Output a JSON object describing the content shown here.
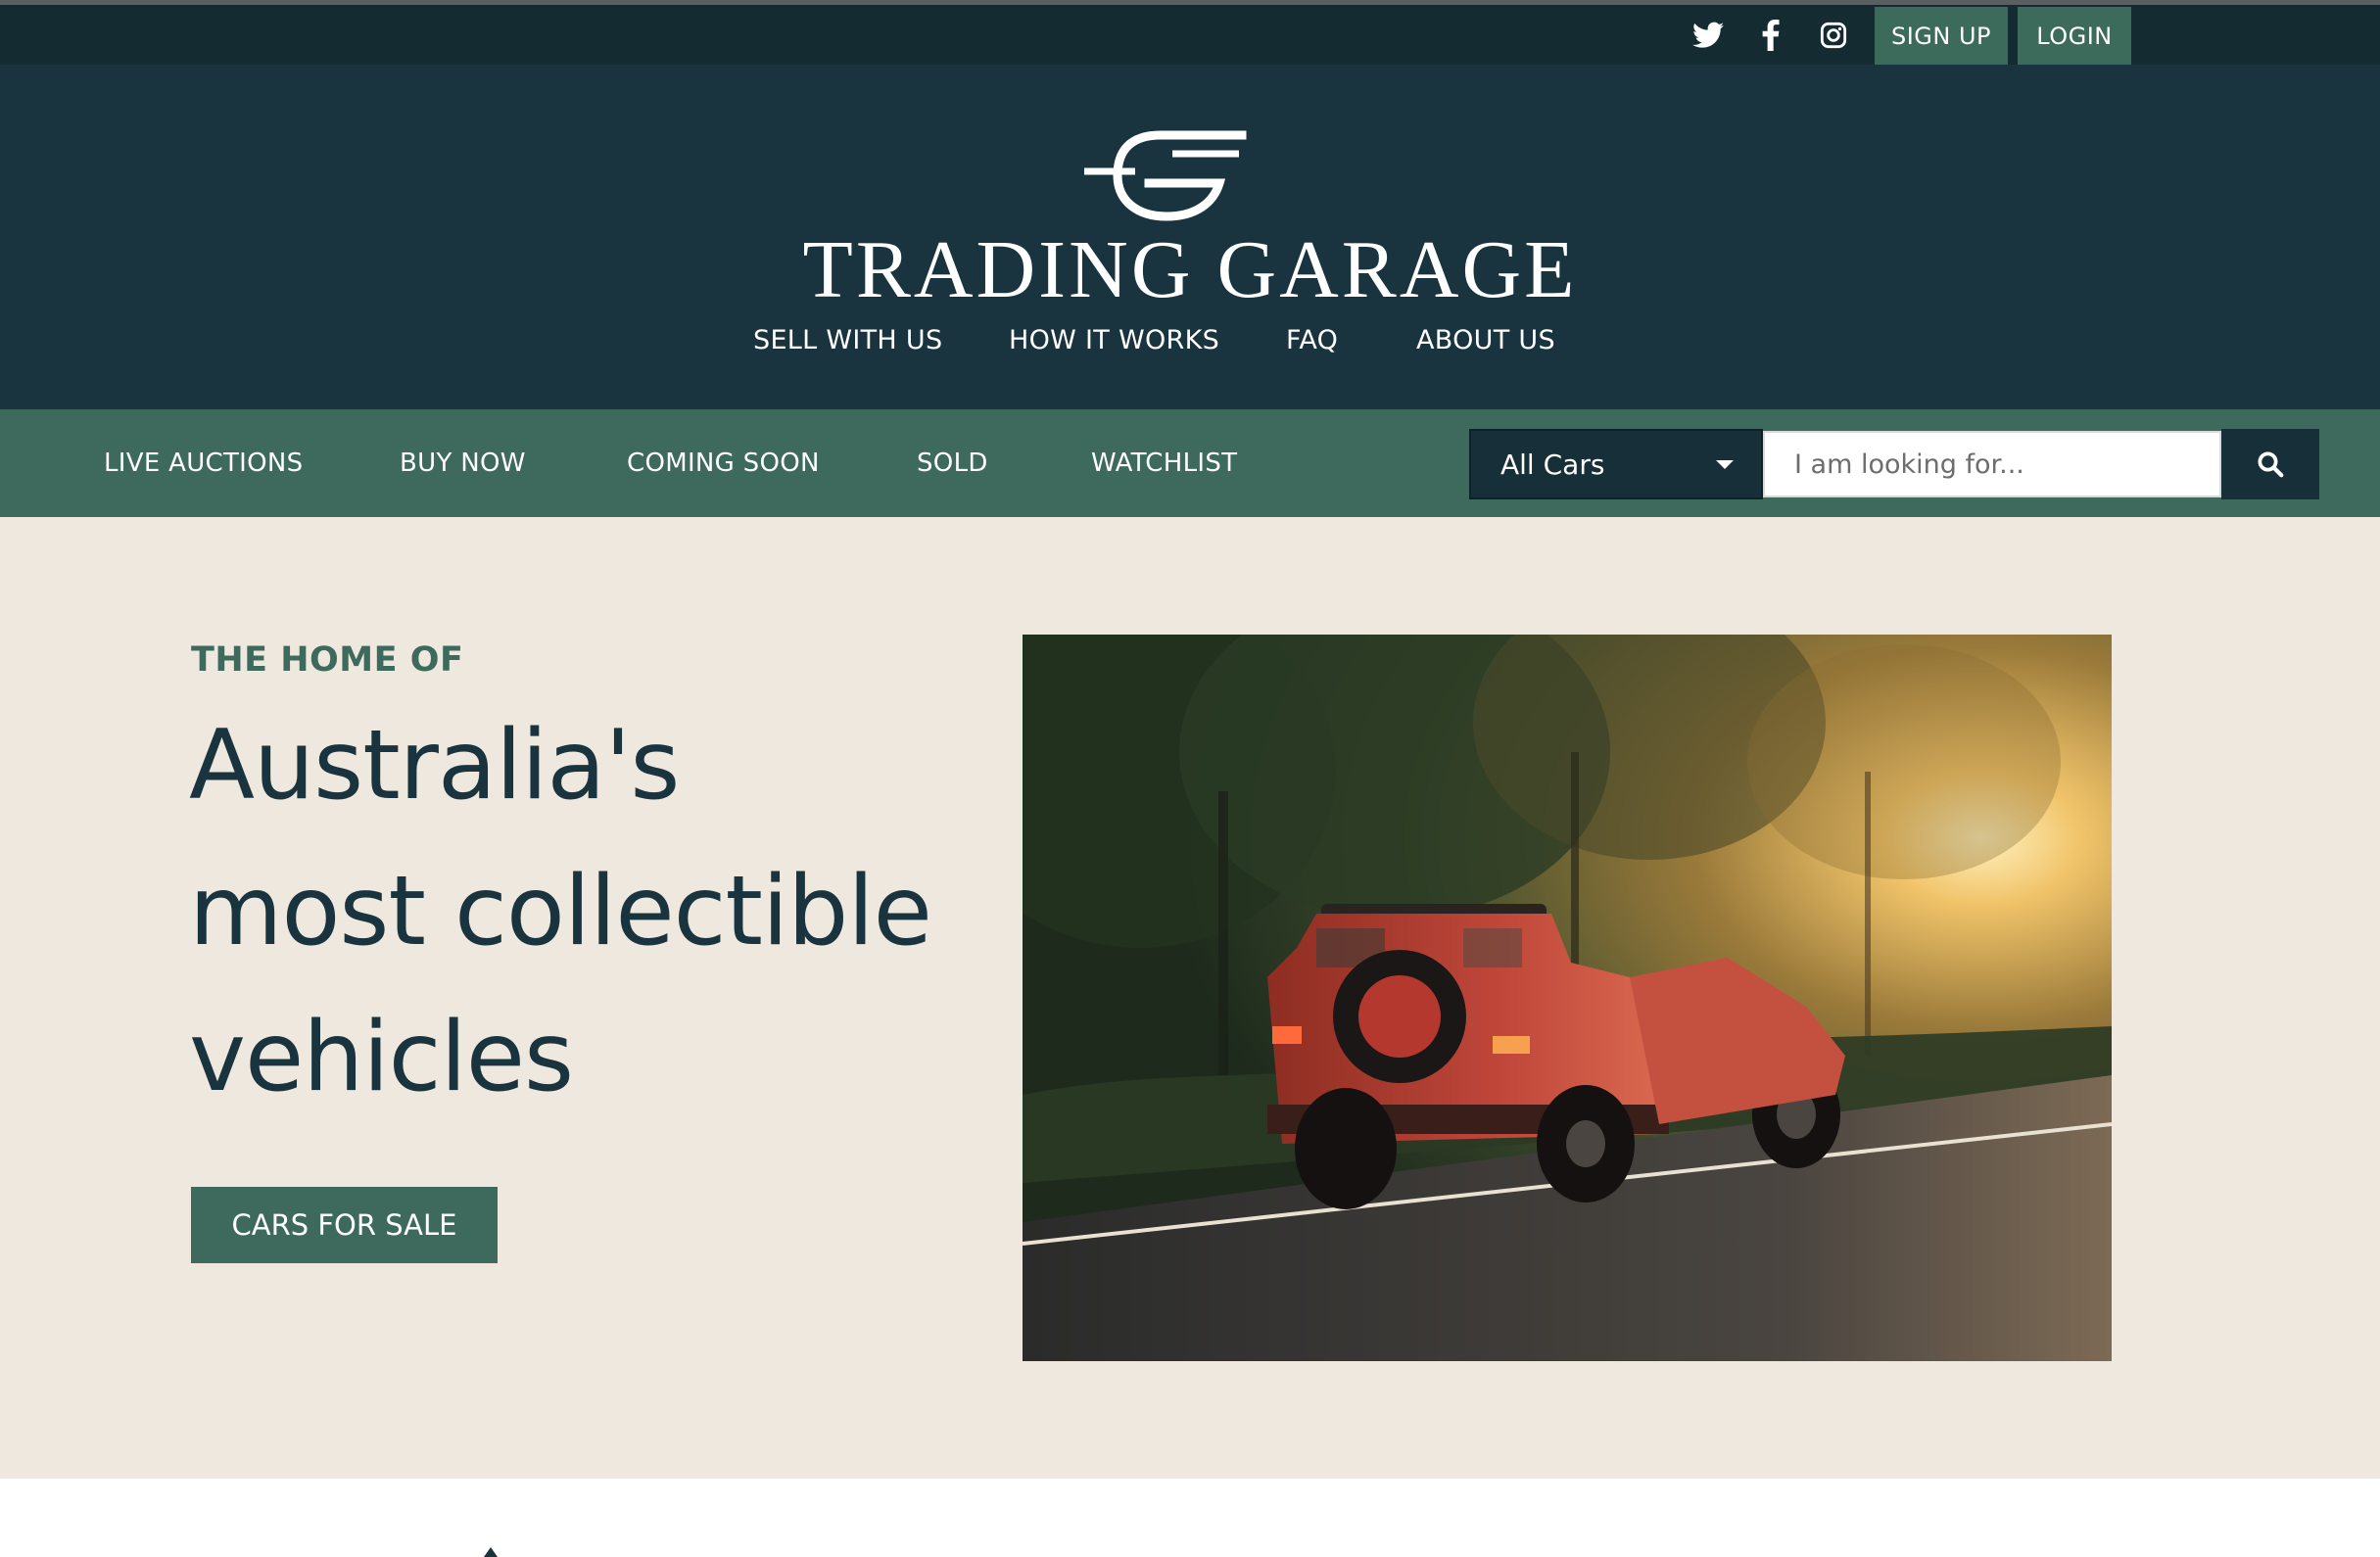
{
  "topbar": {
    "social_icons": [
      "twitter-icon",
      "facebook-icon",
      "instagram-icon"
    ],
    "signup_label": "SIGN UP",
    "login_label": "LOGIN"
  },
  "header": {
    "brand_name": "TRADING GARAGE",
    "nav": [
      "SELL WITH US",
      "HOW IT WORKS",
      "FAQ",
      "ABOUT US"
    ]
  },
  "subnav": {
    "items": [
      "LIVE AUCTIONS",
      "BUY NOW",
      "COMING SOON",
      "SOLD",
      "WATCHLIST"
    ],
    "category_selected": "All Cars",
    "search_placeholder": "I am looking for..."
  },
  "hero": {
    "eyebrow": "THE HOME OF",
    "headline_lines": [
      "Australia's",
      "most collectible",
      "vehicles"
    ],
    "cta_label": "CARS FOR SALE",
    "image_description_icon": "hero-photo"
  },
  "colors": {
    "topbar": "#132b31",
    "header": "#19343f",
    "accent_green": "#3d6a5c",
    "hero_bg": "#efe8df"
  }
}
